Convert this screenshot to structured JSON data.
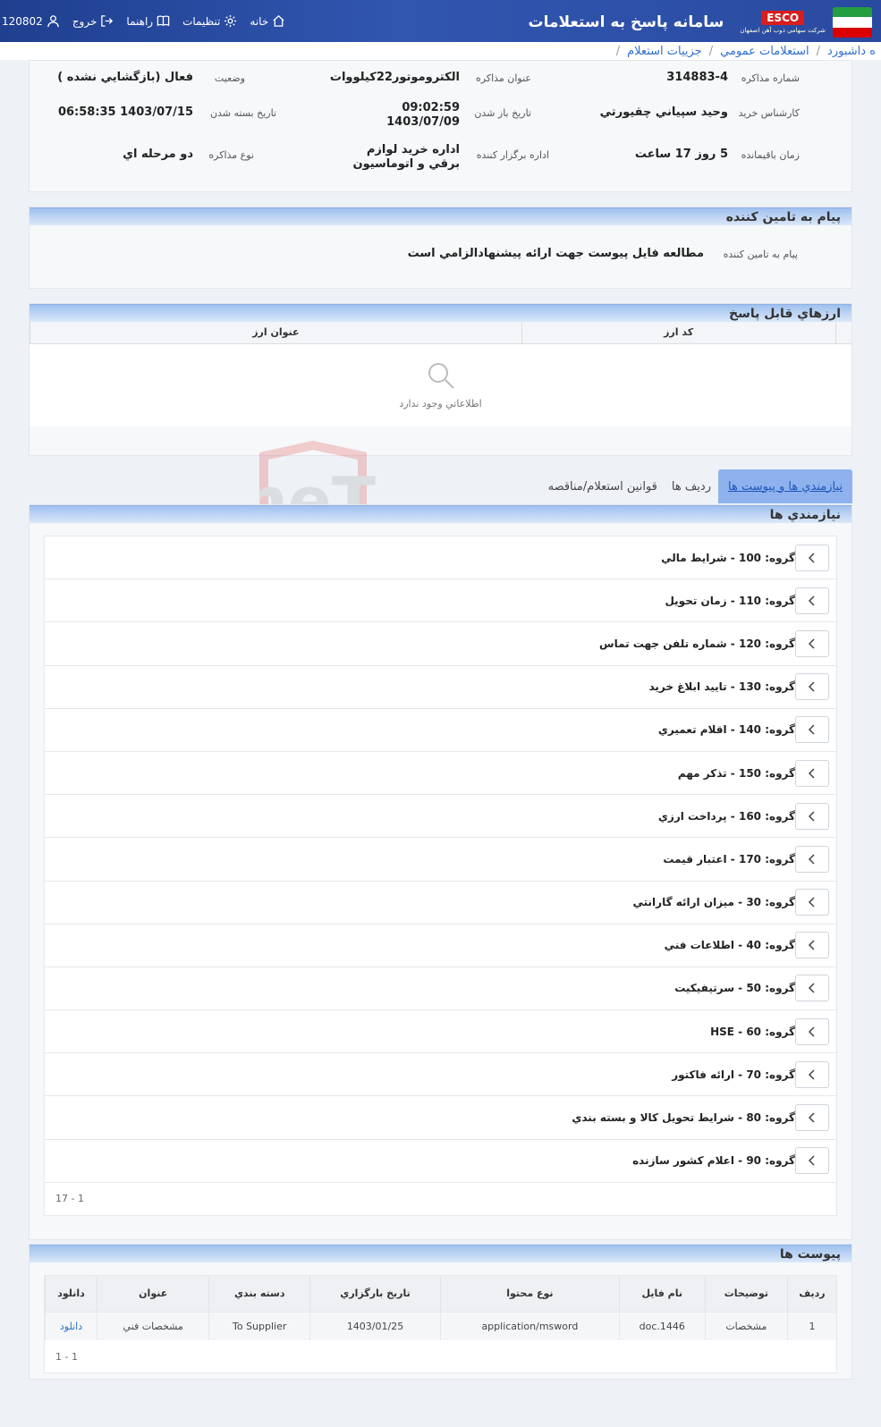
{
  "header": {
    "app_title": "سامانه پاسخ به استعلامات",
    "esco_logo": "ESCO",
    "esco_subtitle": "شركت سهامي ذوب آهن اصفهان",
    "nav": {
      "home": "خانه",
      "settings": "تنظيمات",
      "guide": "راهنما",
      "logout": "خروج",
      "user": "120802"
    }
  },
  "breadcrumb": [
    "ه داشبورد",
    "استعلامات عمومي",
    "جزييات استعلام"
  ],
  "details": {
    "negotiation_number_label": "شماره مذاكره",
    "negotiation_number": "314883-4",
    "negotiation_title_label": "عنوان مذاكره",
    "negotiation_title": "الكتروموتور22كيلووات",
    "status_label": "وضعيت",
    "status": "فعال (بازگشايي نشده )",
    "buyer_expert_label": "كارشناس خريد",
    "buyer_expert": "وحيد سپياني چقيورتي",
    "open_date_label": "تاريخ باز شدن",
    "open_time": "09:02:59",
    "open_date": "1403/07/09",
    "close_date_label": "تاريخ بسته شدن",
    "close_date": "1403/07/15 06:58:35",
    "remaining_label": "زمان باقيمانده",
    "remaining": "5 روز 17 ساعت",
    "organizer_label": "اداره برگزار كننده",
    "organizer": "اداره خريد لوازم برقي و اتوماسيون",
    "type_label": "نوع مذاكره",
    "type": "دو مرحله اي"
  },
  "supplier_message": {
    "title": "پيام به تامين كننده",
    "label": "پيام به تامين كننده",
    "text": "مطالعه فايل پيوست جهت ارائه پيشنهادالزامي است"
  },
  "currencies": {
    "title": "ارزهاي قابل پاسخ",
    "col_code": "كد ارز",
    "col_title": "عنوان ارز",
    "empty": "اطلاعاتي وجود ندارد"
  },
  "tabs": [
    "نيازمندي ها و پيوست ها",
    "رديف ها",
    "قوانين استعلام/مناقصه"
  ],
  "requirements": {
    "title": "نيازمندي ها",
    "groups": [
      "گروه: 100 - شرايط مالي",
      "گروه: 110 - زمان تحويل",
      "گروه: 120 - شماره تلفن جهت تماس",
      "گروه: 130 - تاييد ابلاغ خريد",
      "گروه: 140 - اقلام تعميري",
      "گروه: 150 - تذكر مهم",
      "گروه: 160 - پرداخت ارزي",
      "گروه: 170 - اعتبار قيمت",
      "گروه: 30 - ميزان ارائه گارانتي",
      "گروه: 40 - اطلاعات فني",
      "گروه: 50 - سرتيفيكيت",
      "گروه: 60 - HSE",
      "گروه: 70 - ارائه فاكتور",
      "گروه: 80 - شرايط تحويل كالا و بسته بندي",
      "گروه: 90 - اعلام كشور سازنده"
    ],
    "pager": "17 - 1"
  },
  "attachments": {
    "title": "پيوست ها",
    "columns": [
      "رديف",
      "توضيحات",
      "نام فايل",
      "نوع محتوا",
      "تاريخ بارگزاري",
      "دسته بندي",
      "عنوان",
      "دانلود"
    ],
    "rows": [
      [
        "1",
        "مشخصات",
        "doc.1446",
        "application/msword",
        "1403/01/25",
        "To Supplier",
        "مشخصات فني",
        "دانلود"
      ]
    ],
    "pager": "1 - 1"
  },
  "watermark": "AriaTender.neT",
  "colors": {
    "header_blue": "#2a4aa0",
    "link_blue": "#2f6fd0",
    "tab_active": "#8fb2ee",
    "esco_red": "#d81e1e"
  }
}
